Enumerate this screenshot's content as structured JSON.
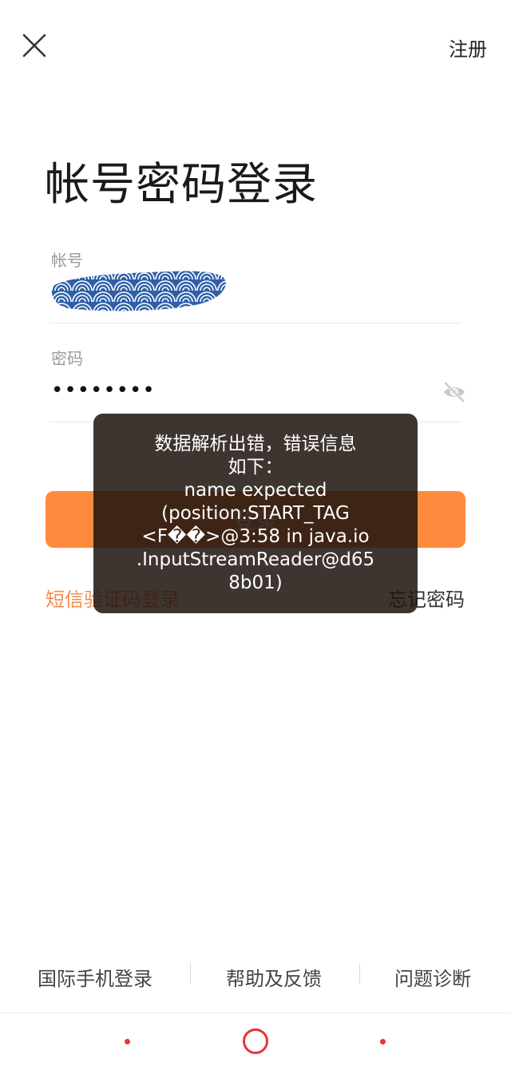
{
  "header": {
    "close_icon": "close-icon",
    "register_label": "注册"
  },
  "form": {
    "title": "帐号密码登录",
    "account_label": "帐号",
    "password_label": "密码",
    "password_value": "••••••••",
    "eye_icon": "eye-off-icon",
    "login_button_label": "登录",
    "sms_login_label": "短信验证码登录",
    "forgot_password_label": "忘记密码"
  },
  "toast": {
    "lines": [
      "数据解析出错，错误信息",
      "如下：",
      "name expected",
      "(position:START_TAG",
      "<F��>@3:58 in java.io",
      ".InputStreamReader@d65",
      "8b01)"
    ]
  },
  "bottom_links": {
    "items": [
      "国际手机登录",
      "帮助及反馈",
      "问题诊断"
    ]
  },
  "colors": {
    "accent": "#ff8a3d",
    "sms_link": "#f58a4c",
    "nav_red": "#e8333a",
    "toast_bg": "#1e140f"
  }
}
